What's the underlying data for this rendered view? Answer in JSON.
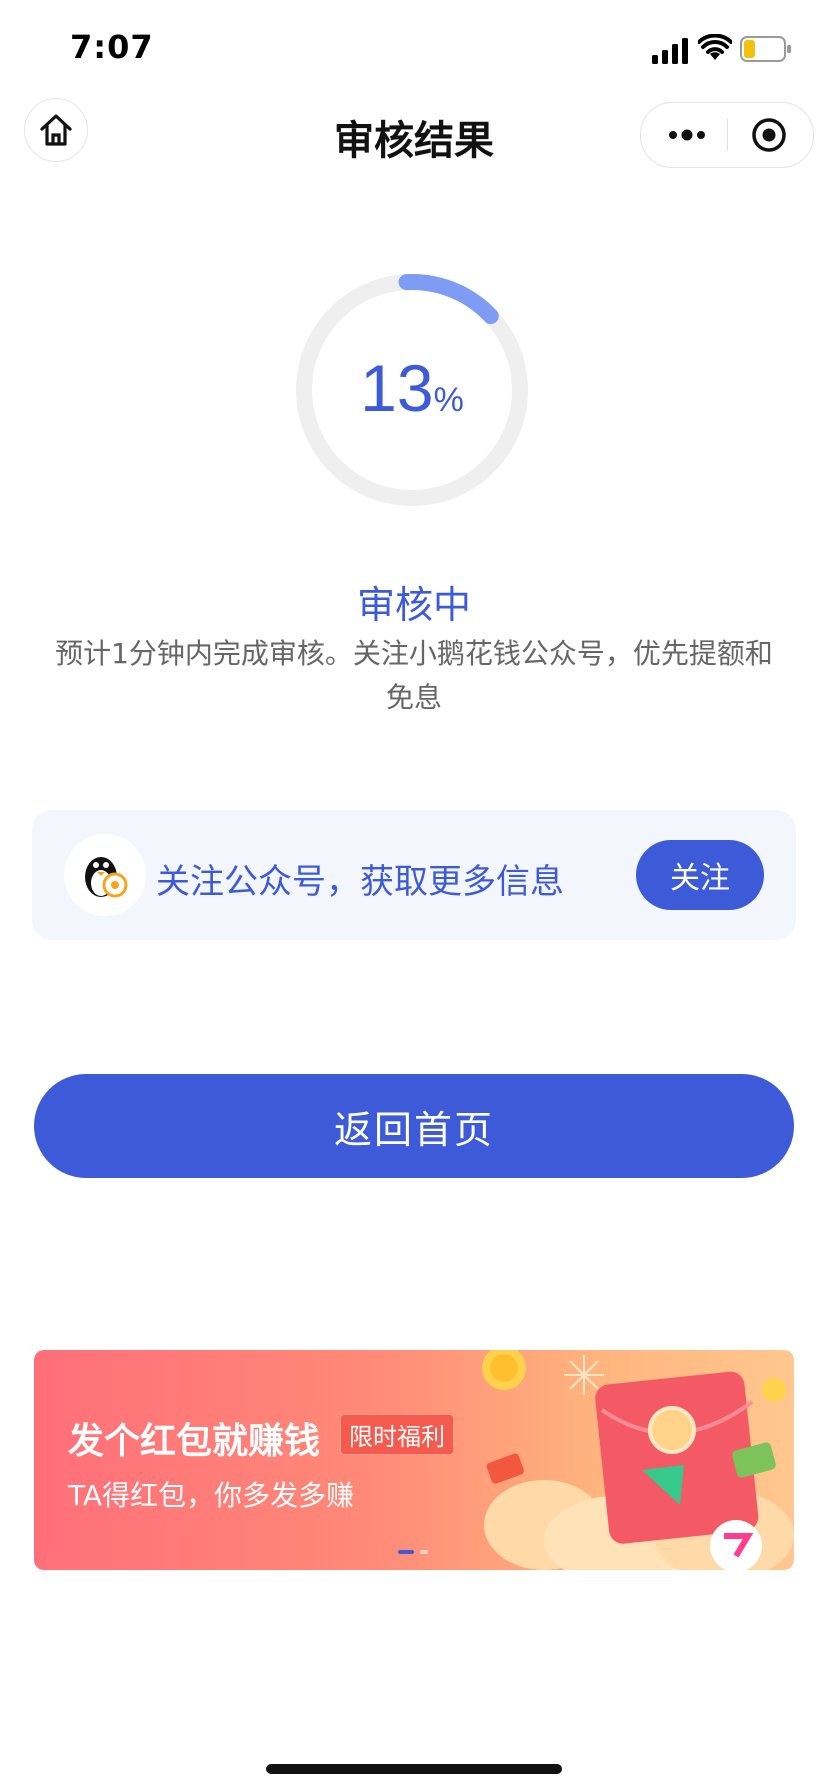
{
  "status_bar": {
    "time": "7:07",
    "battery_color": "#f4c20d"
  },
  "nav": {
    "title": "审核结果",
    "home_icon": "home-icon",
    "more_icon": "more-icon",
    "close_icon": "target-icon"
  },
  "progress": {
    "value": 13,
    "number": "13",
    "unit": "%",
    "color": "#3d5bd9",
    "track_color": "#efefef",
    "arc_color": "#7f9cf5"
  },
  "status": {
    "title": "审核中",
    "description_line1": "预计1分钟内完成审核。关注小鹅花钱公众号，优先提额和",
    "description_line2": "免息"
  },
  "follow_card": {
    "text": "关注公众号，获取更多信息",
    "button_label": "关注",
    "avatar_icon": "penguin-icon"
  },
  "main_button": {
    "label": "返回首页"
  },
  "banner": {
    "title": "发个红包就赚钱",
    "tag": "限时福利",
    "subtitle": "TA得红包，你多发多赚",
    "active_slide": 1,
    "slide_count": 2
  },
  "colors": {
    "accent": "#3d5bd9",
    "card_bg": "#f4f6fd"
  }
}
